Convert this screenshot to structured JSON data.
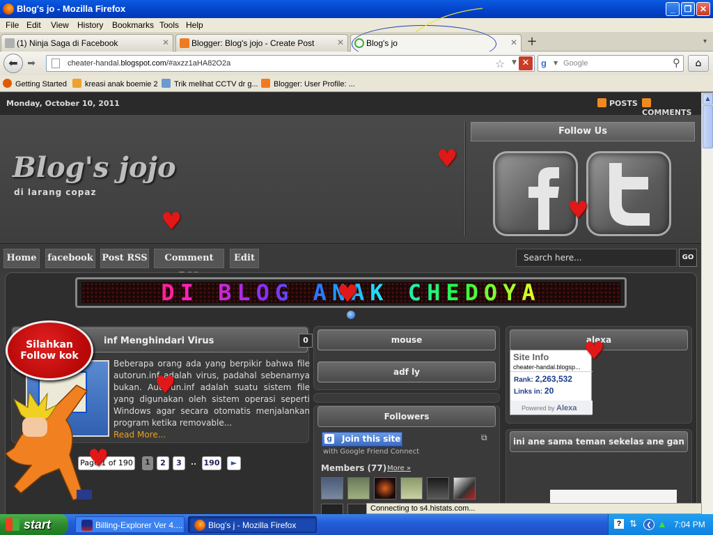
{
  "window": {
    "title": "Blog's jo - Mozilla Firefox"
  },
  "menu": [
    "File",
    "Edit",
    "View",
    "History",
    "Bookmarks",
    "Tools",
    "Help"
  ],
  "tabs": [
    {
      "label": "(1) Ninja Saga di Facebook"
    },
    {
      "label": "Blogger: Blog's jojo - Create Post"
    },
    {
      "label": "Blog's jo"
    }
  ],
  "nav": {
    "url_prefix": "cheater-handal.",
    "url_domain": "blogspot.com",
    "url_suffix": "/#axzz1aHA82O2a",
    "search_placeholder": "Google",
    "search_engine_letter": "g"
  },
  "bookmarks": [
    {
      "label": "Getting Started",
      "color": "#e05a00"
    },
    {
      "label": "kreasi anak boemie 2",
      "color": "#f0a030"
    },
    {
      "label": "Trik melihat CCTV dr g...",
      "color": "#6a9ad0"
    },
    {
      "label": "Blogger: User Profile: ...",
      "color": "#f07a20"
    }
  ],
  "page": {
    "date": "Monday, October 10, 2011",
    "rss_posts": "POSTS",
    "rss_comments": "COMMENTS",
    "blog_title": "Blog's jojo",
    "blog_desc": "di larang copaz",
    "follow_us": "Follow Us",
    "nav_items": [
      "Home",
      "facebook",
      "Post RSS",
      "Comment RSS",
      "Edit"
    ],
    "search_placeholder": "Search here...",
    "go": "GO",
    "marquee": "DI BLOG ANAK CHEDOYA",
    "post": {
      "title": "inf Menghindari Virus",
      "comments": "0",
      "text": "Beberapa orang ada yang berpikir bahwa file autorun.inf adalah virus, padahal sebenarnya bukan. Autorun.inf adalah suatu sistem file yang digunakan oleh sistem operasi seperti Windows agar secara otomatis menjalankan program ketika removable...",
      "read_more": "Read More..."
    },
    "follow_badge": "Silahkan Follow kok",
    "pager": {
      "label": "Page 1 of 190",
      "pages": [
        "1",
        "2",
        "3"
      ],
      "ellipsis": "..",
      "last": "190",
      "next": "►"
    },
    "widgets": {
      "mouse": "mouse",
      "adfly": "adf ly",
      "followers": "Followers",
      "join": "Join this site",
      "join_sub": "with Google Friend Connect",
      "members": "Members (77)",
      "more": "More »",
      "alexa": "alexa",
      "site_info": "Site Info",
      "alexa_domain": "cheater-handal.blogsp...",
      "rank_label": "Rank:",
      "rank": "2,263,532",
      "links_label": "Links in:",
      "links": "20",
      "powered": "Powered by",
      "alexa_brand": "Alexa",
      "classmates": "ini ane sama teman sekelas ane gan"
    }
  },
  "status": "Connecting to s4.histats.com...",
  "taskbar": {
    "start": "start",
    "items": [
      {
        "label": "Billing-Explorer Ver 4...."
      },
      {
        "label": "Blog's j - Mozilla Firefox"
      }
    ],
    "clock": "7:04 PM"
  }
}
